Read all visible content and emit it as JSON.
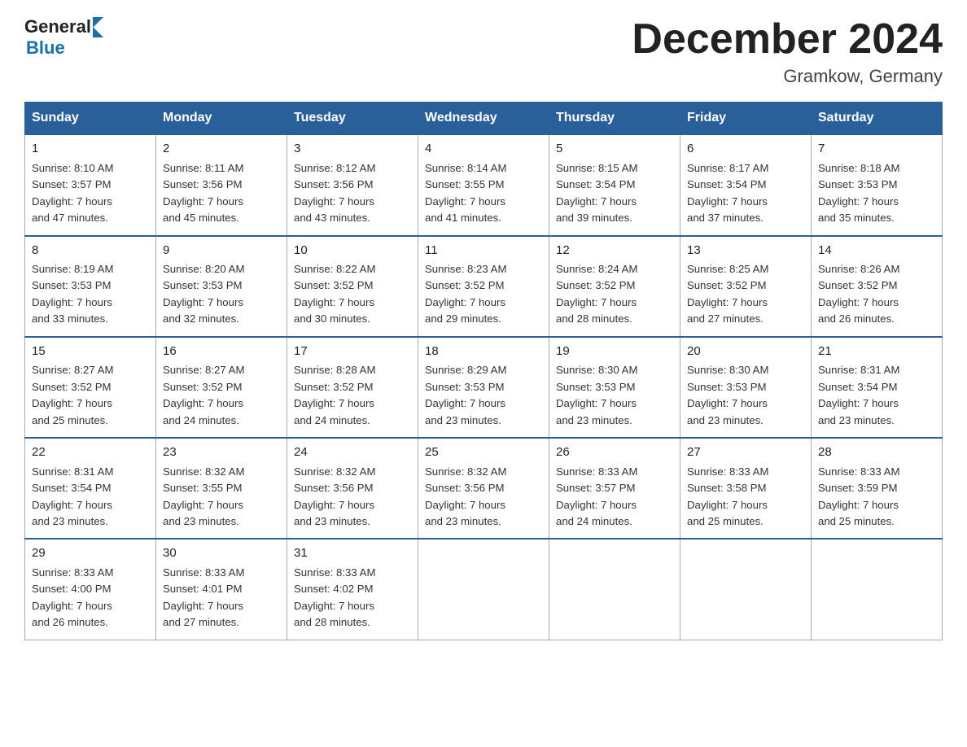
{
  "header": {
    "logo_general": "General",
    "logo_blue": "Blue",
    "title": "December 2024",
    "subtitle": "Gramkow, Germany"
  },
  "days_of_week": [
    "Sunday",
    "Monday",
    "Tuesday",
    "Wednesday",
    "Thursday",
    "Friday",
    "Saturday"
  ],
  "weeks": [
    [
      {
        "day": "1",
        "sunrise": "8:10 AM",
        "sunset": "3:57 PM",
        "daylight": "7 hours and 47 minutes."
      },
      {
        "day": "2",
        "sunrise": "8:11 AM",
        "sunset": "3:56 PM",
        "daylight": "7 hours and 45 minutes."
      },
      {
        "day": "3",
        "sunrise": "8:12 AM",
        "sunset": "3:56 PM",
        "daylight": "7 hours and 43 minutes."
      },
      {
        "day": "4",
        "sunrise": "8:14 AM",
        "sunset": "3:55 PM",
        "daylight": "7 hours and 41 minutes."
      },
      {
        "day": "5",
        "sunrise": "8:15 AM",
        "sunset": "3:54 PM",
        "daylight": "7 hours and 39 minutes."
      },
      {
        "day": "6",
        "sunrise": "8:17 AM",
        "sunset": "3:54 PM",
        "daylight": "7 hours and 37 minutes."
      },
      {
        "day": "7",
        "sunrise": "8:18 AM",
        "sunset": "3:53 PM",
        "daylight": "7 hours and 35 minutes."
      }
    ],
    [
      {
        "day": "8",
        "sunrise": "8:19 AM",
        "sunset": "3:53 PM",
        "daylight": "7 hours and 33 minutes."
      },
      {
        "day": "9",
        "sunrise": "8:20 AM",
        "sunset": "3:53 PM",
        "daylight": "7 hours and 32 minutes."
      },
      {
        "day": "10",
        "sunrise": "8:22 AM",
        "sunset": "3:52 PM",
        "daylight": "7 hours and 30 minutes."
      },
      {
        "day": "11",
        "sunrise": "8:23 AM",
        "sunset": "3:52 PM",
        "daylight": "7 hours and 29 minutes."
      },
      {
        "day": "12",
        "sunrise": "8:24 AM",
        "sunset": "3:52 PM",
        "daylight": "7 hours and 28 minutes."
      },
      {
        "day": "13",
        "sunrise": "8:25 AM",
        "sunset": "3:52 PM",
        "daylight": "7 hours and 27 minutes."
      },
      {
        "day": "14",
        "sunrise": "8:26 AM",
        "sunset": "3:52 PM",
        "daylight": "7 hours and 26 minutes."
      }
    ],
    [
      {
        "day": "15",
        "sunrise": "8:27 AM",
        "sunset": "3:52 PM",
        "daylight": "7 hours and 25 minutes."
      },
      {
        "day": "16",
        "sunrise": "8:27 AM",
        "sunset": "3:52 PM",
        "daylight": "7 hours and 24 minutes."
      },
      {
        "day": "17",
        "sunrise": "8:28 AM",
        "sunset": "3:52 PM",
        "daylight": "7 hours and 24 minutes."
      },
      {
        "day": "18",
        "sunrise": "8:29 AM",
        "sunset": "3:53 PM",
        "daylight": "7 hours and 23 minutes."
      },
      {
        "day": "19",
        "sunrise": "8:30 AM",
        "sunset": "3:53 PM",
        "daylight": "7 hours and 23 minutes."
      },
      {
        "day": "20",
        "sunrise": "8:30 AM",
        "sunset": "3:53 PM",
        "daylight": "7 hours and 23 minutes."
      },
      {
        "day": "21",
        "sunrise": "8:31 AM",
        "sunset": "3:54 PM",
        "daylight": "7 hours and 23 minutes."
      }
    ],
    [
      {
        "day": "22",
        "sunrise": "8:31 AM",
        "sunset": "3:54 PM",
        "daylight": "7 hours and 23 minutes."
      },
      {
        "day": "23",
        "sunrise": "8:32 AM",
        "sunset": "3:55 PM",
        "daylight": "7 hours and 23 minutes."
      },
      {
        "day": "24",
        "sunrise": "8:32 AM",
        "sunset": "3:56 PM",
        "daylight": "7 hours and 23 minutes."
      },
      {
        "day": "25",
        "sunrise": "8:32 AM",
        "sunset": "3:56 PM",
        "daylight": "7 hours and 23 minutes."
      },
      {
        "day": "26",
        "sunrise": "8:33 AM",
        "sunset": "3:57 PM",
        "daylight": "7 hours and 24 minutes."
      },
      {
        "day": "27",
        "sunrise": "8:33 AM",
        "sunset": "3:58 PM",
        "daylight": "7 hours and 25 minutes."
      },
      {
        "day": "28",
        "sunrise": "8:33 AM",
        "sunset": "3:59 PM",
        "daylight": "7 hours and 25 minutes."
      }
    ],
    [
      {
        "day": "29",
        "sunrise": "8:33 AM",
        "sunset": "4:00 PM",
        "daylight": "7 hours and 26 minutes."
      },
      {
        "day": "30",
        "sunrise": "8:33 AM",
        "sunset": "4:01 PM",
        "daylight": "7 hours and 27 minutes."
      },
      {
        "day": "31",
        "sunrise": "8:33 AM",
        "sunset": "4:02 PM",
        "daylight": "7 hours and 28 minutes."
      },
      null,
      null,
      null,
      null
    ]
  ]
}
